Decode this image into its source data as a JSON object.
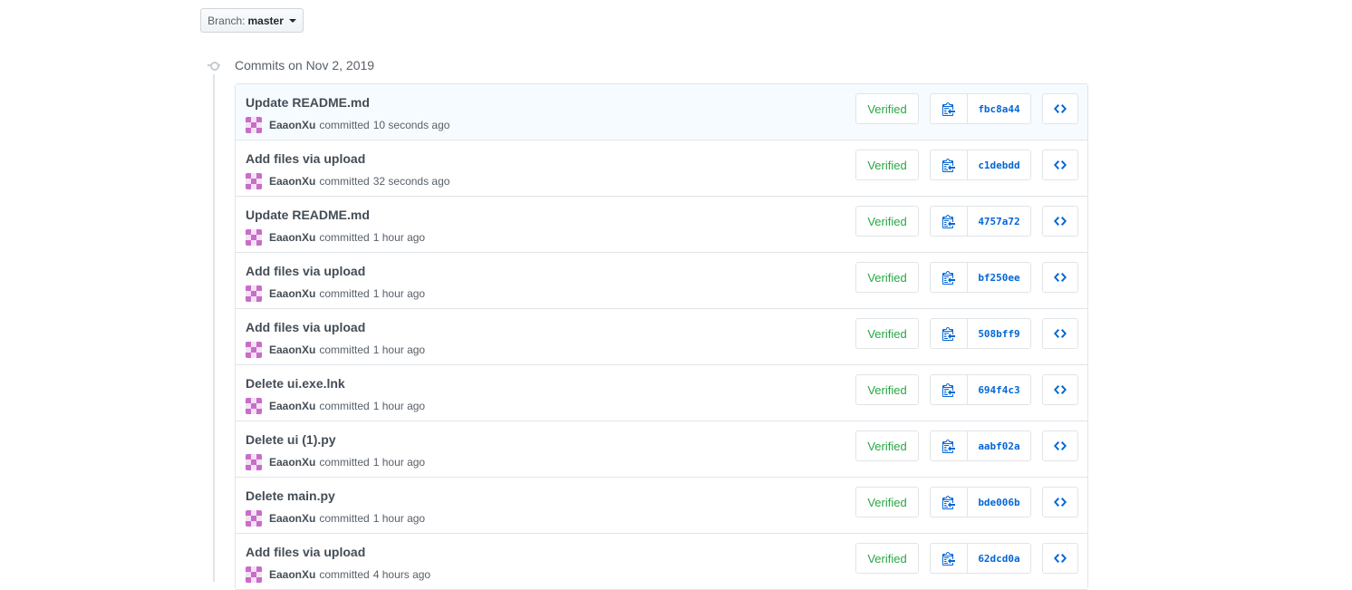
{
  "branch": {
    "label": "Branch:",
    "value": "master"
  },
  "group": {
    "title": "Commits on Nov 2, 2019"
  },
  "commits": [
    {
      "message": "Update README.md",
      "author": "EaaonXu",
      "action": "committed",
      "time": "10 seconds ago",
      "verified": "Verified",
      "sha": "fbc8a44"
    },
    {
      "message": "Add files via upload",
      "author": "EaaonXu",
      "action": "committed",
      "time": "32 seconds ago",
      "verified": "Verified",
      "sha": "c1debdd"
    },
    {
      "message": "Update README.md",
      "author": "EaaonXu",
      "action": "committed",
      "time": "1 hour ago",
      "verified": "Verified",
      "sha": "4757a72"
    },
    {
      "message": "Add files via upload",
      "author": "EaaonXu",
      "action": "committed",
      "time": "1 hour ago",
      "verified": "Verified",
      "sha": "bf250ee"
    },
    {
      "message": "Add files via upload",
      "author": "EaaonXu",
      "action": "committed",
      "time": "1 hour ago",
      "verified": "Verified",
      "sha": "508bff9"
    },
    {
      "message": "Delete ui.exe.lnk",
      "author": "EaaonXu",
      "action": "committed",
      "time": "1 hour ago",
      "verified": "Verified",
      "sha": "694f4c3"
    },
    {
      "message": "Delete ui (1).py",
      "author": "EaaonXu",
      "action": "committed",
      "time": "1 hour ago",
      "verified": "Verified",
      "sha": "aabf02a"
    },
    {
      "message": "Delete main.py",
      "author": "EaaonXu",
      "action": "committed",
      "time": "1 hour ago",
      "verified": "Verified",
      "sha": "bde006b"
    },
    {
      "message": "Add files via upload",
      "author": "EaaonXu",
      "action": "committed",
      "time": "4 hours ago",
      "verified": "Verified",
      "sha": "62dcd0a"
    }
  ],
  "icons": {
    "branch_caret": "caret-down-icon",
    "timeline": "git-commit-icon",
    "copy": "clippy-icon",
    "browse": "code-icon",
    "avatar": "identicon"
  },
  "colors": {
    "verified": "#28a745",
    "sha": "#0366d6",
    "avatar": "#c86dc9"
  }
}
